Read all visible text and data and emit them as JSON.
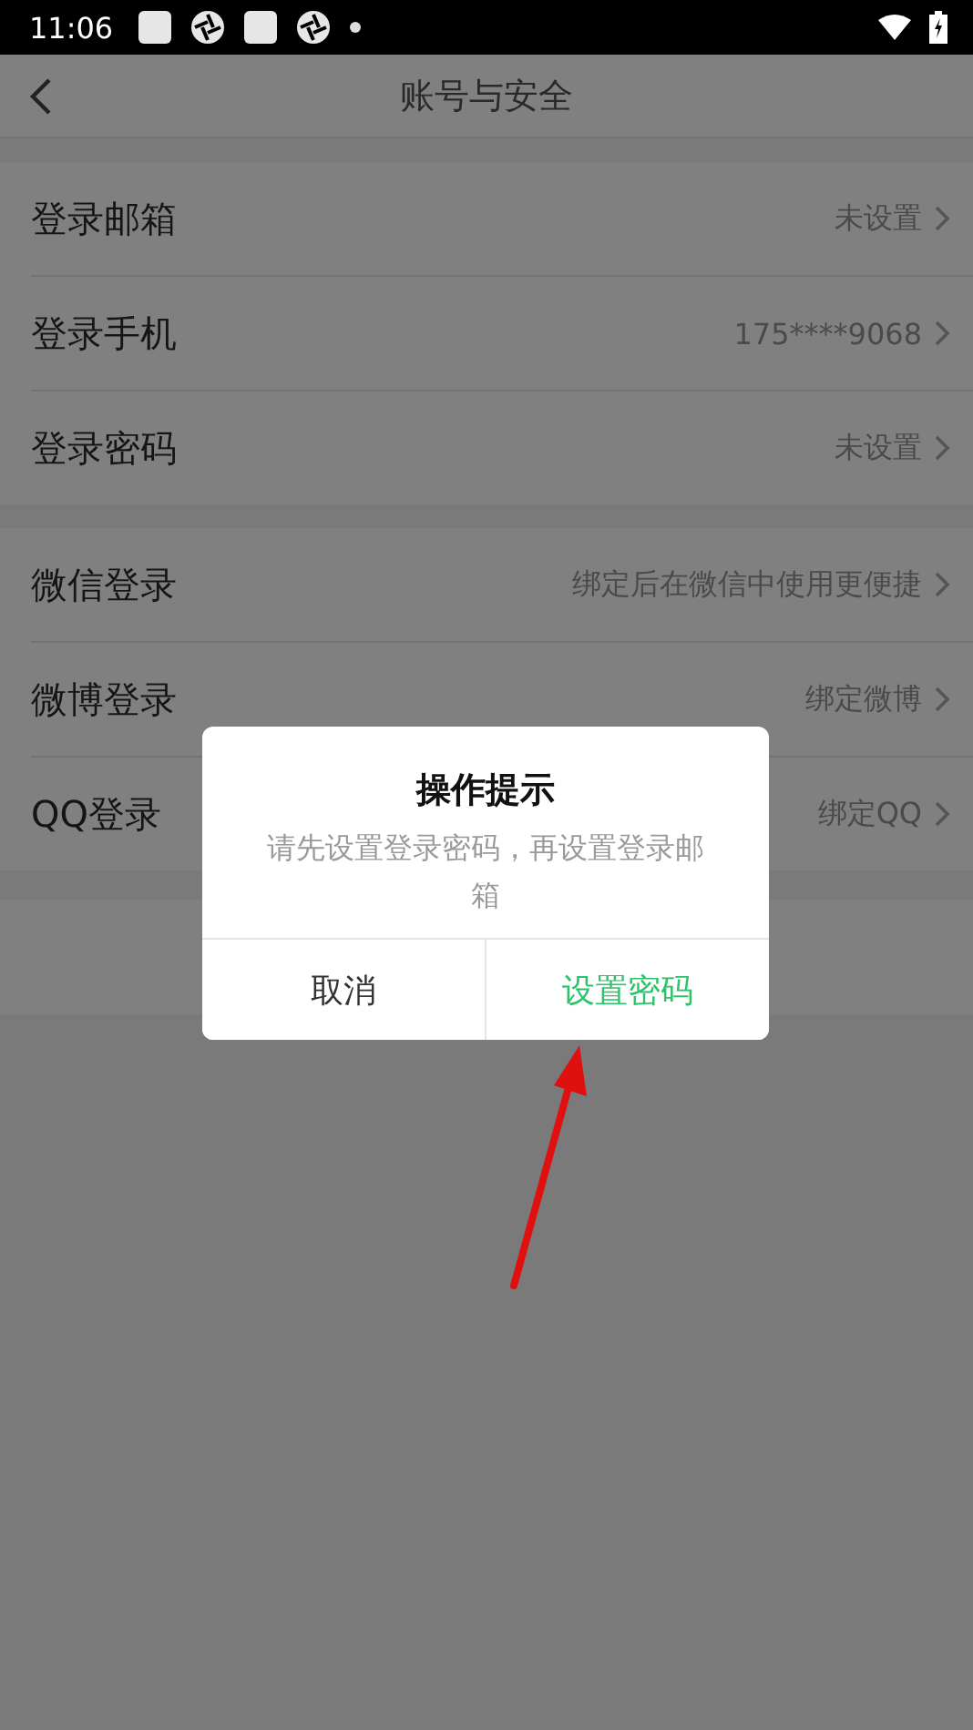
{
  "status_bar": {
    "time": "11:06"
  },
  "header": {
    "title": "账号与安全"
  },
  "sections": [
    {
      "rows": [
        {
          "label": "登录邮箱",
          "value": "未设置"
        },
        {
          "label": "登录手机",
          "value": "175****9068"
        },
        {
          "label": "登录密码",
          "value": "未设置"
        }
      ]
    },
    {
      "rows": [
        {
          "label": "微信登录",
          "value": "绑定后在微信中使用更便捷"
        },
        {
          "label": "微博登录",
          "value": "绑定微博"
        },
        {
          "label": "QQ登录",
          "value": "绑定QQ"
        }
      ]
    }
  ],
  "dialog": {
    "title": "操作提示",
    "message": "请先设置登录密码，再设置登录邮箱",
    "buttons": [
      {
        "label": "取消",
        "kind": "cancel"
      },
      {
        "label": "设置密码",
        "kind": "confirm"
      }
    ]
  }
}
